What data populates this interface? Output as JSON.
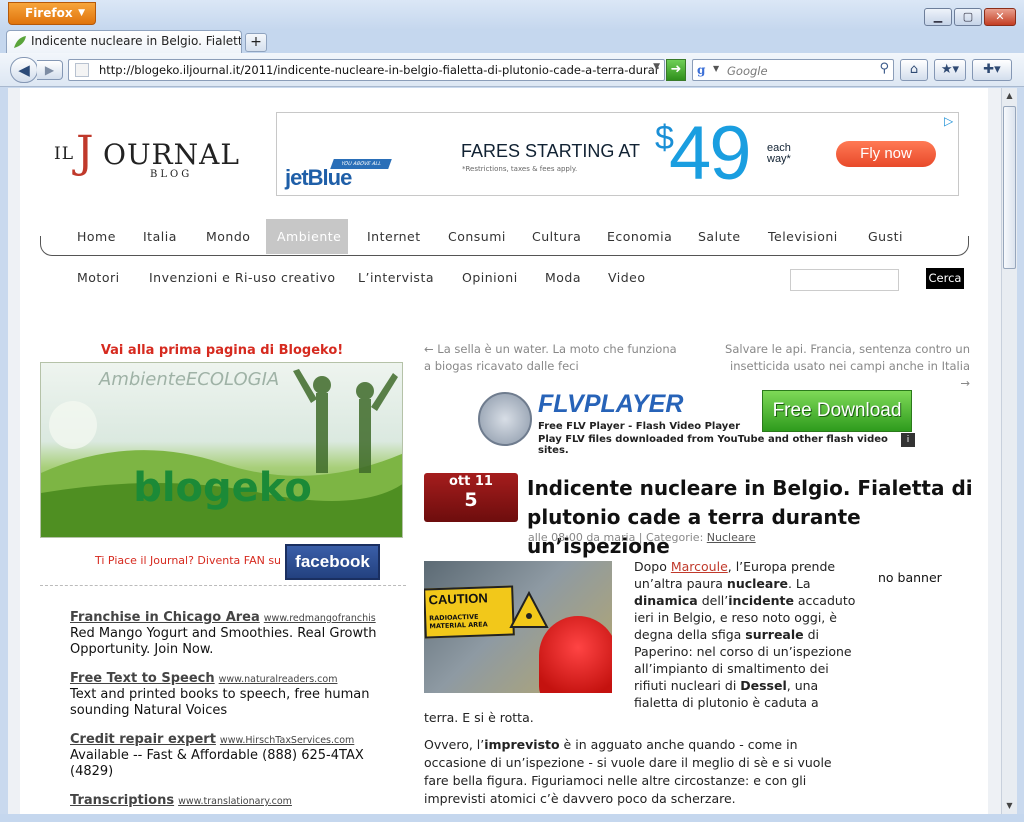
{
  "browser": {
    "menu_label": "Firefox",
    "tab_title": "Indicente nucleare in Belgio. Fialetta di p...",
    "url": "http://blogeko.iljournal.it/2011/indicente-nucleare-in-belgio-fialetta-di-plutonio-cade-a-terra-durante-unispez",
    "search_placeholder": "Google"
  },
  "site": {
    "logo_il": "IL",
    "logo_j": "J",
    "logo_ournal": "OURNAL",
    "logo_blog": "BLOG",
    "ad_jetblue": {
      "brand": "jetBlue",
      "tag": "YOU ABOVE ALL",
      "headline": "FARES STARTING AT",
      "fine_print": "*Restrictions, taxes & fees apply.",
      "currency": "$",
      "price": "49",
      "each_way": "each way*",
      "cta": "Fly now"
    },
    "nav_primary": [
      "Home",
      "Italia",
      "Mondo",
      "Ambiente",
      "Internet",
      "Consumi",
      "Cultura",
      "Economia",
      "Salute",
      "Televisioni",
      "Gusti"
    ],
    "nav_secondary": [
      "Motori",
      "Invenzioni e Ri-uso creativo",
      "L’intervista",
      "Opinioni",
      "Moda",
      "Video"
    ],
    "search_button": "Cerca"
  },
  "sidebar": {
    "title": "Vai alla prima pagina di Blogeko!",
    "banner_text": "blogeko",
    "banner_sub": "AmbienteECOLOGIA",
    "fan_text": "Ti Piace il Journal? Diventa FAN su",
    "facebook": "facebook",
    "ads": [
      {
        "title": "Franchise in Chicago Area",
        "url": "www.redmangofranchis",
        "desc": "Red Mango Yogurt and Smoothies. Real Growth Opportunity. Join Now."
      },
      {
        "title": "Free Text to Speech",
        "url": "www.naturalreaders.com",
        "desc": "Text and printed books to speech, free human sounding Natural Voices"
      },
      {
        "title": "Credit repair expert",
        "url": "www.HirschTaxServices.com",
        "desc": "Available -- Fast & Affordable (888) 625-4TAX (4829)"
      },
      {
        "title": "Transcriptions",
        "url": "www.translationary.com",
        "desc": ""
      }
    ]
  },
  "article": {
    "prev": "← La sella è un water. La moto che funziona a biogas ricavato dalle feci",
    "next": "Salvare le api. Francia, sentenza contro un insetticida usato nei campi anche in Italia →",
    "flv": {
      "logo": "FLVPLAYER",
      "sub1": "Free FLV Player - Flash Video Player",
      "sub2": "Play FLV files downloaded from YouTube and other flash video sites.",
      "cta": "Free Download"
    },
    "date_month": "ott 11",
    "date_day": "5",
    "title": "Indicente nucleare in Belgio. Fialetta di plutonio cade a terra durante un’ispezione",
    "meta_prefix": "alle 08:00 da maria | Categorie:",
    "meta_category": "Nucleare",
    "caution": "CAUTION",
    "caution_sub": "RADIOACTIVE MATERIAL AREA",
    "p1_a": "Dopo ",
    "p1_link": "Marcoule",
    "p1_b": ", l’Europa prende un’altra paura ",
    "p1_bold1": "nucleare",
    "p1_c": ". La ",
    "p1_bold2": "dinamica",
    "p1_d": " dell’",
    "p1_bold3": "incidente",
    "p1_e": " accaduto ieri in Belgio, e reso noto oggi, è degna della sfiga ",
    "p1_bold4": "surreale",
    "p1_f": " di Paperino: nel corso di un’ispezione all’impianto di smaltimento dei rifiuti nucleari di ",
    "p1_bold5": "Dessel",
    "p1_g": ", una fialetta di plutonio è caduta a",
    "p1_tail": "terra. E si è rotta.",
    "p2_a": "Ovvero, l’",
    "p2_bold": "imprevisto",
    "p2_b": " è in agguato anche quando - come in occasione di un’ispezione - si vuole dare il meglio di sè e si vuole fare bella figura. Figuriamoci nelle altre circostanze: e con gli imprevisti atomici c’è davvero poco da scherzare.",
    "no_banner": "no banner"
  },
  "colors": {
    "accent_red": "#d62a1f",
    "date_box": "#8b1414",
    "nav_active": "#c7c7c7"
  }
}
